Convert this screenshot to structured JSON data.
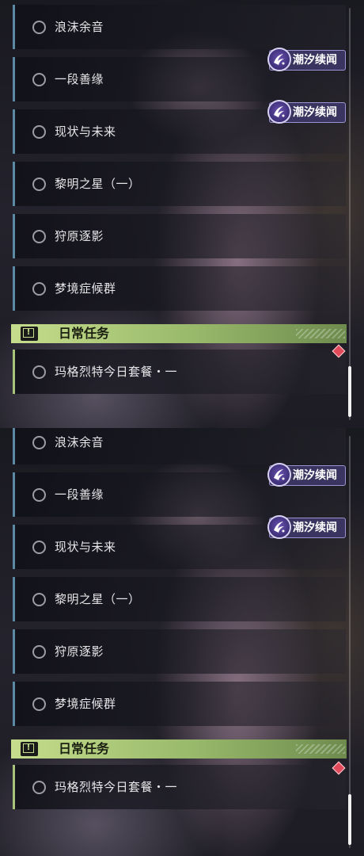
{
  "frames": [
    {
      "quests": [
        {
          "label": "浪沫余音"
        },
        {
          "label": "一段善缘"
        },
        {
          "label": "现状与未来"
        },
        {
          "label": "黎明之星（一）"
        },
        {
          "label": "狩原逐影"
        },
        {
          "label": "梦境症候群"
        }
      ],
      "tags": [
        {
          "label": "潮汐续闻",
          "icon": "tide-emblem-icon"
        },
        {
          "label": "潮汐续闻",
          "icon": "tide-emblem-icon"
        }
      ],
      "daily_section": {
        "title": "日常任务",
        "icon": "exclamation-icon",
        "quests": [
          {
            "label": "玛格烈特今日套餐・一"
          }
        ]
      }
    },
    {
      "quests": [
        {
          "label": "浪沫余音"
        },
        {
          "label": "一段善缘"
        },
        {
          "label": "现状与未来"
        },
        {
          "label": "黎明之星（一）"
        },
        {
          "label": "狩原逐影"
        },
        {
          "label": "梦境症候群"
        }
      ],
      "tags": [
        {
          "label": "潮汐续闻",
          "icon": "tide-emblem-icon"
        },
        {
          "label": "潮汐续闻",
          "icon": "tide-emblem-icon"
        }
      ],
      "daily_section": {
        "title": "日常任务",
        "icon": "exclamation-icon",
        "quests": [
          {
            "label": "玛格烈特今日套餐・一"
          }
        ]
      }
    }
  ],
  "colors": {
    "story_accent": "#5c8aa6",
    "daily_accent": "#a8c47a",
    "tag_bg": "#3a3560",
    "alert_diamond": "#e04a5a"
  }
}
